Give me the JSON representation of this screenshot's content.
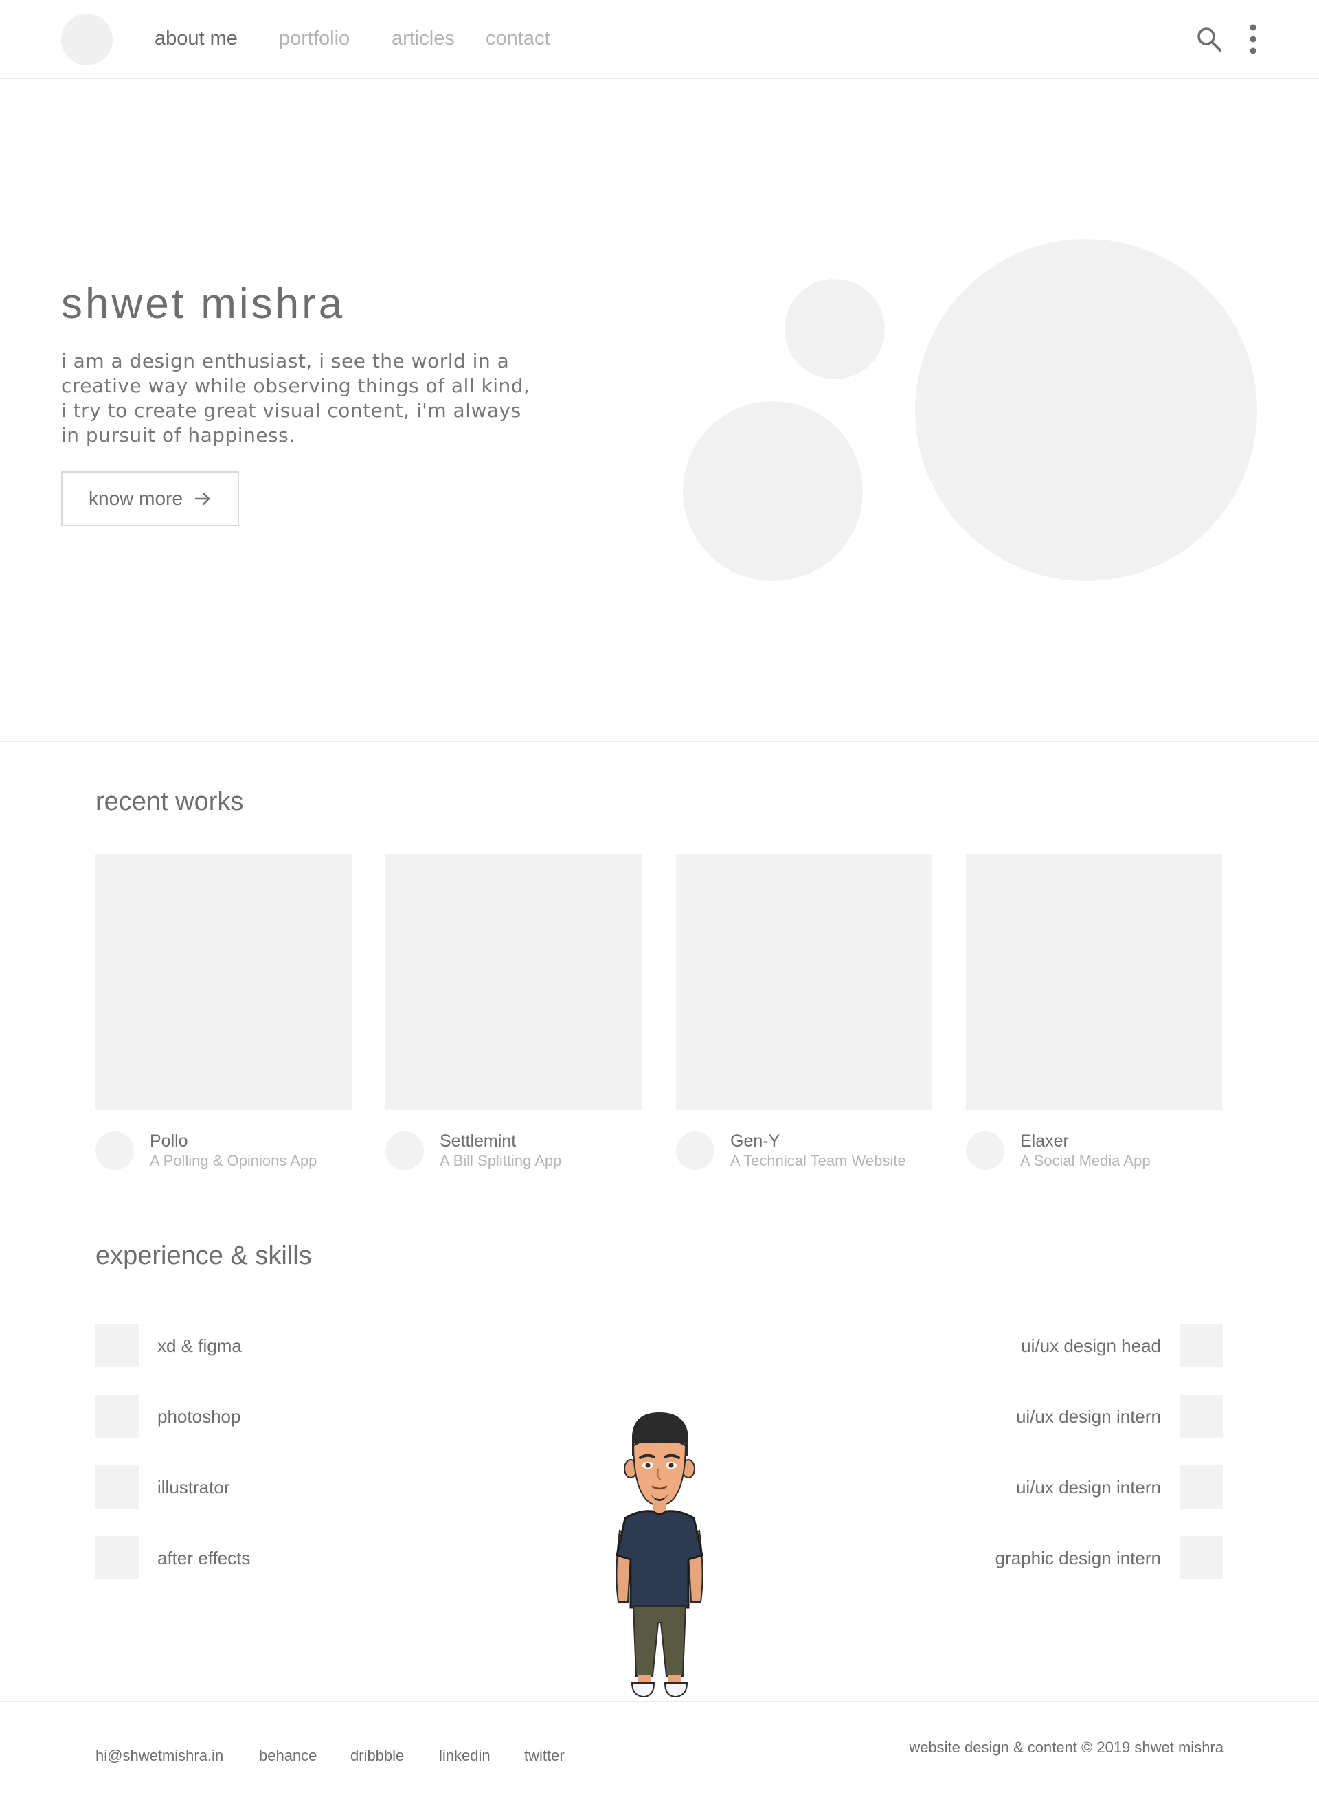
{
  "header": {
    "nav": [
      {
        "label": "about me",
        "active": true
      },
      {
        "label": "portfolio",
        "active": false
      },
      {
        "label": "articles",
        "active": false
      },
      {
        "label": "contact",
        "active": false
      }
    ],
    "icons": [
      "search-icon",
      "more-vertical-icon"
    ]
  },
  "hero": {
    "title": "shwet mishra",
    "description": "i am a design enthusiast, i see the world in a creative way while observing things of all kind, i try to create great visual content, i'm always in pursuit of happiness.",
    "button_label": "know more",
    "button_icon": "arrow-right-icon"
  },
  "works": {
    "title": "recent works",
    "items": [
      {
        "name": "Pollo",
        "subtitle": "A Polling & Opinions App"
      },
      {
        "name": "Settlemint",
        "subtitle": "A Bill Splitting App"
      },
      {
        "name": "Gen-Y",
        "subtitle": "A Technical Team Website"
      },
      {
        "name": "Elaxer",
        "subtitle": "A Social Media App"
      }
    ]
  },
  "experience": {
    "title": "experience & skills",
    "skills": [
      "xd & figma",
      "photoshop",
      "illustrator",
      "after effects"
    ],
    "roles": [
      "ui/ux design head",
      "ui/ux design intern",
      "ui/ux design intern",
      "graphic design intern"
    ]
  },
  "footer": {
    "links": [
      "hi@shwetmishra.in",
      "behance",
      "dribbble",
      "linkedin",
      "twitter"
    ],
    "copyright": "website design & content © 2019 shwet mishra"
  },
  "colors": {
    "text": "#6e6e6e",
    "muted": "#b4b4b4",
    "placeholder": "#f2f2f2",
    "divider": "#ececec"
  }
}
